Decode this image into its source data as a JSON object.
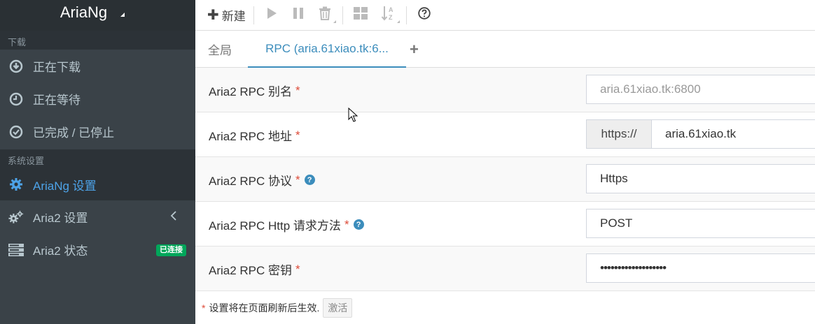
{
  "app": {
    "logo": "AriaNg"
  },
  "sidebar": {
    "section_download": "下载",
    "items_download": [
      {
        "label": "正在下载",
        "icon": "download-circle-icon"
      },
      {
        "label": "正在等待",
        "icon": "clock-icon"
      },
      {
        "label": "已完成 / 已停止",
        "icon": "check-circle-icon"
      }
    ],
    "section_settings": "系统设置",
    "items_settings": [
      {
        "label": "AriaNg 设置",
        "icon": "gear-icon"
      },
      {
        "label": "Aria2 设置",
        "icon": "gears-icon"
      },
      {
        "label": "Aria2 状态",
        "icon": "server-icon",
        "badge": "已连接"
      }
    ]
  },
  "toolbar": {
    "new_label": "新建",
    "icons": [
      "play-icon",
      "pause-icon",
      "delete-icon",
      "grid-icon",
      "sort-icon",
      "help-icon"
    ]
  },
  "tabs": {
    "global": "全局",
    "rpc": "RPC (aria.61xiao.tk:6...",
    "add": "+"
  },
  "form": {
    "rows": [
      {
        "label": "Aria2 RPC 别名",
        "value": "aria.61xiao.tk:6800"
      },
      {
        "label": "Aria2 RPC 地址",
        "addon": "https://",
        "value": "aria.61xiao.tk"
      },
      {
        "label": "Aria2 RPC 协议",
        "value": "Https"
      },
      {
        "label": "Aria2 RPC Http 请求方法",
        "value": "POST"
      },
      {
        "label": "Aria2 RPC 密钥",
        "value": "•••••••••••••••••••"
      }
    ],
    "required_mark": "*",
    "help_mark": "?"
  },
  "footer": {
    "note": "设置将在页面刷新后生效.",
    "activate_label": "激活"
  },
  "colors": {
    "accent": "#3c8dbc",
    "sidebar_bg": "#3a4248",
    "success": "#00a65a",
    "required": "#dd4b39"
  }
}
